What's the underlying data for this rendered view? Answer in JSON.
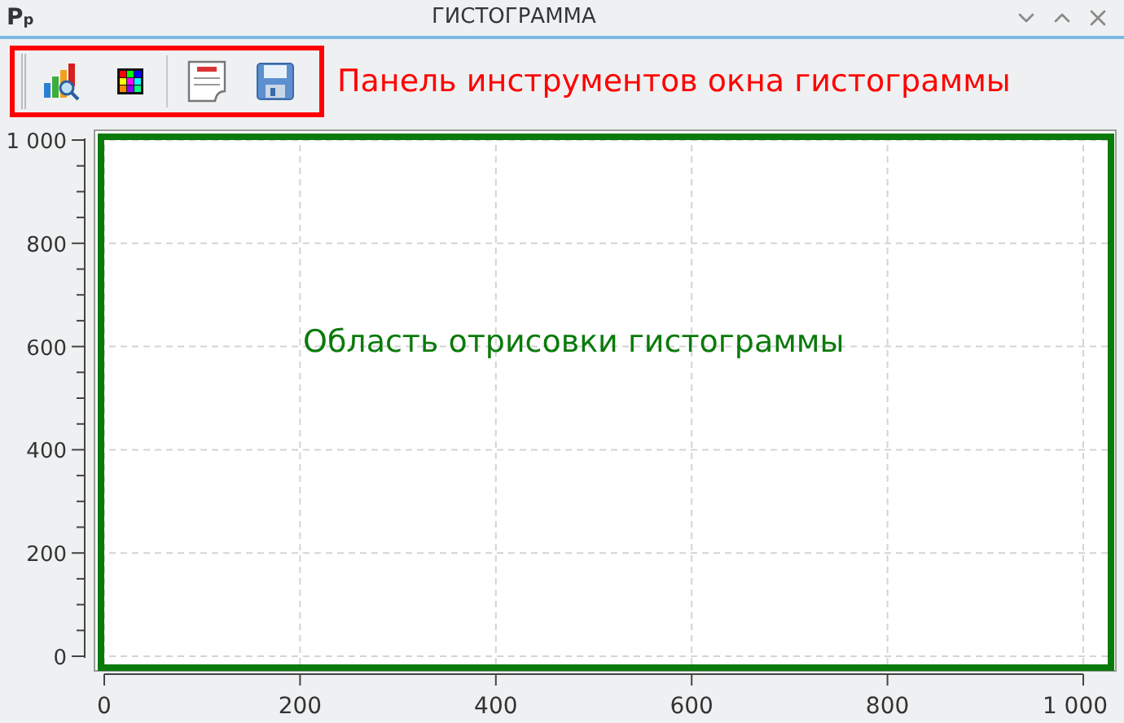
{
  "window": {
    "logo": "Pp",
    "title": "ГИСТОГРАММА"
  },
  "toolbar": {
    "buttons": [
      {
        "kind": "chart"
      },
      {
        "kind": "palette"
      },
      {
        "kind": "document"
      },
      {
        "kind": "save"
      }
    ],
    "callout": "Панель инструментов окна гистограммы"
  },
  "histogram": {
    "callout": "Область отрисовки гистограммы",
    "chart_data": {
      "type": "bar",
      "grid": true,
      "xlim": [
        0,
        1000
      ],
      "ylim": [
        0,
        1000
      ],
      "xticks": [
        0,
        200,
        400,
        600,
        800,
        {
          "value": 1000,
          "label": "1 000"
        }
      ],
      "yticks": [
        0,
        200,
        400,
        600,
        800,
        {
          "value": 1000,
          "label": "1 000"
        }
      ]
    }
  }
}
